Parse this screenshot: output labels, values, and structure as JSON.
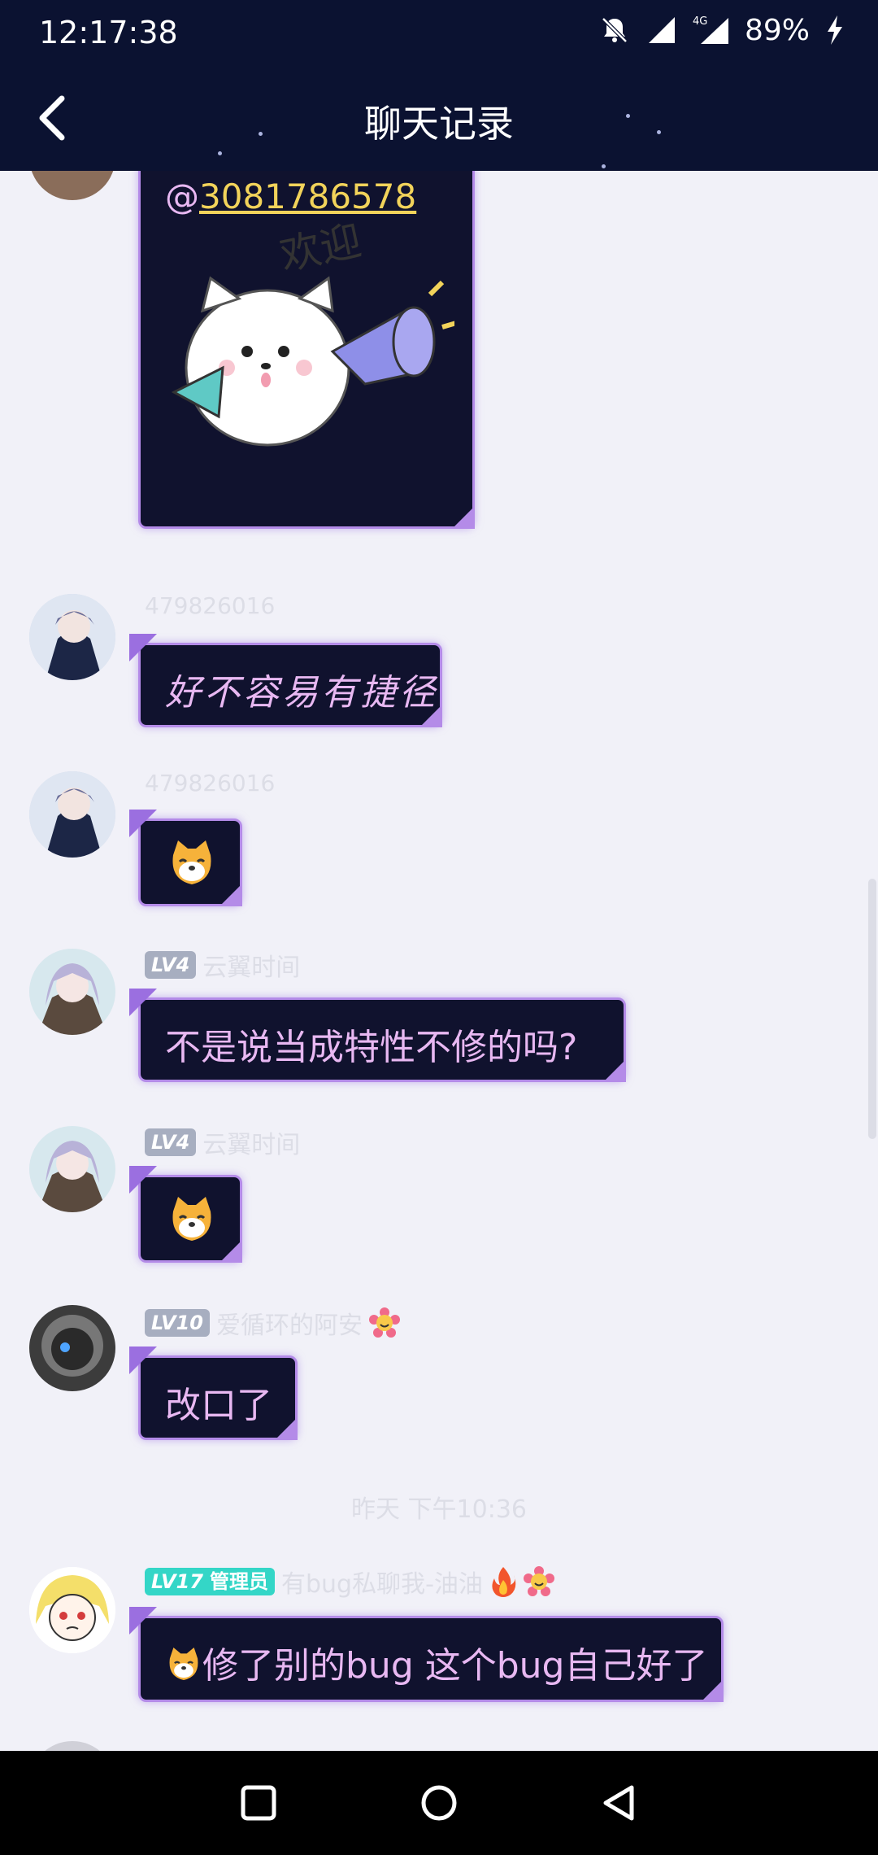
{
  "status_bar": {
    "time": "12:17:38",
    "battery": "89%",
    "network": "4G",
    "icons": [
      "bell-off-icon",
      "signal-icon",
      "signal-4g-icon",
      "charging-icon"
    ]
  },
  "header": {
    "title": "聊天记录",
    "back_icon": "chevron-left-icon"
  },
  "messages": [
    {
      "mention": "3081786578",
      "at": "@",
      "sticker": "welcome-cat-megaphone-sticker",
      "sticker_text": "欢迎"
    },
    {
      "sender_id": "479826016",
      "text": "好不容易有捷径"
    },
    {
      "sender_id": "479826016",
      "emoji": "dog-face-emoji"
    },
    {
      "level": "LV4",
      "nickname": "云翼时间",
      "text": "不是说当成特性不修的吗?"
    },
    {
      "level": "LV4",
      "nickname": "云翼时间",
      "emoji": "dog-face-emoji"
    },
    {
      "level": "LV10",
      "nickname": "爱循环的阿安",
      "badge": "flower-smile-icon",
      "text": "改口了"
    },
    {
      "divider_time": "昨天 下午10:36"
    },
    {
      "level": "LV17",
      "role": "管理员",
      "nickname": "有bug私聊我-油油",
      "badges": [
        "fire-icon",
        "flower-smile-icon"
      ],
      "text": "修了别的bug 这个bug自己好了"
    }
  ],
  "nav_bar": {
    "recents_icon": "square-icon",
    "home_icon": "circle-icon",
    "back_icon": "triangle-back-icon"
  },
  "colors": {
    "header_bg": "#0b1231",
    "bubble_bg": "#10122e",
    "bubble_border": "#b48be8",
    "bubble_text": "#e8b8f2",
    "mention": "#f2d35a",
    "admin_badge": "#34d6c7",
    "chat_bg": "#f1f1f8"
  }
}
